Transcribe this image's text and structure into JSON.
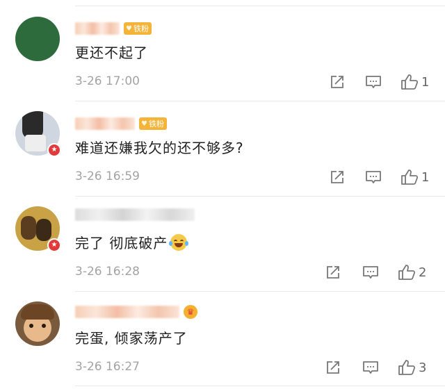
{
  "comments": [
    {
      "fan_label": "铁粉",
      "text": "更还不起了",
      "time": "3-26 17:00",
      "likes": "1",
      "avatar_color": "#2e6b3c"
    },
    {
      "fan_label": "铁粉",
      "text": "难道还嫌我欠的还不够多?",
      "time": "3-26 16:59",
      "likes": "1",
      "avatar_color": "#cfd6df"
    },
    {
      "text": "完了 彻底破产",
      "emoji": "laughing-crying-emoji",
      "time": "3-26 16:28",
      "likes": "2",
      "avatar_color": "#c9a246"
    },
    {
      "text": "完蛋, 倾家荡产了",
      "time": "3-26 16:27",
      "likes": "3",
      "avatar_color": "#7a5a3c"
    }
  ],
  "icons": {
    "share": "share-icon",
    "reply": "comment-icon",
    "like": "thumbs-up-icon"
  },
  "colors": {
    "fan_badge": "#f4b43a",
    "vip_badge": "#e03a3a",
    "meta_text": "#a3a3a3"
  }
}
